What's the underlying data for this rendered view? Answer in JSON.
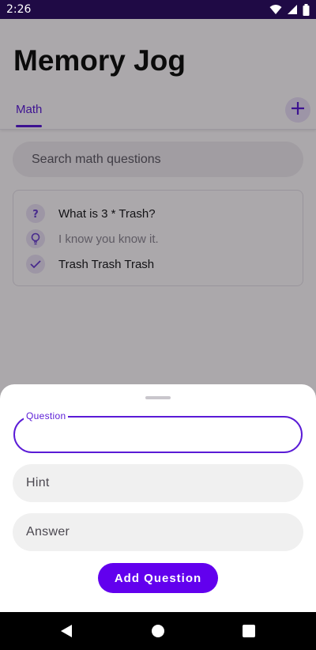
{
  "status_bar": {
    "time": "2:26"
  },
  "app": {
    "title": "Memory Jog",
    "tabs": [
      {
        "label": "Math",
        "selected": true
      }
    ],
    "add_tab_icon": "plus-icon",
    "search": {
      "placeholder": "Search math questions"
    },
    "question_card": {
      "question": "What is 3 * Trash?",
      "hint": "I know you know it.",
      "answer": "Trash Trash Trash"
    }
  },
  "bottom_sheet": {
    "question_field": {
      "label": "Question",
      "value": ""
    },
    "hint_field": {
      "placeholder": "Hint"
    },
    "answer_field": {
      "placeholder": "Answer"
    },
    "add_button_label": "Add Question"
  },
  "colors": {
    "primary": "#6200ee",
    "status_bar": "#1f0a45"
  }
}
